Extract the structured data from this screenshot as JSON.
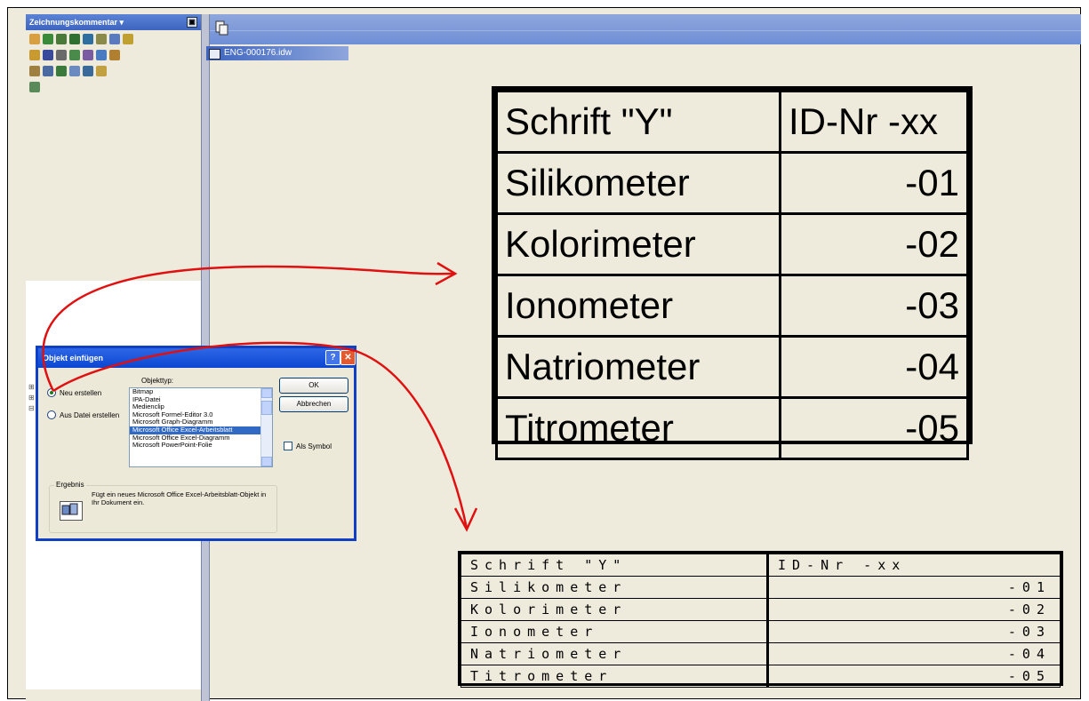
{
  "panel": {
    "title": "Zeichnungskommentar ▾"
  },
  "document": {
    "tab_title": "ENG-000176.idw"
  },
  "big_table": {
    "header": [
      "Schrift \"Y\"",
      "ID-Nr -xx"
    ],
    "rows": [
      [
        "Silikometer",
        "-01"
      ],
      [
        "Kolorimeter",
        "-02"
      ],
      [
        "Ionometer",
        "-03"
      ],
      [
        "Natriometer",
        "-04"
      ],
      [
        "Titrometer",
        "-05"
      ]
    ]
  },
  "small_table": {
    "header": [
      "Schrift \"Y\"",
      "ID-Nr -xx"
    ],
    "rows": [
      [
        "Silikometer",
        "-01"
      ],
      [
        "Kolorimeter",
        "-02"
      ],
      [
        "Ionometer",
        "-03"
      ],
      [
        "Natriometer",
        "-04"
      ],
      [
        "Titrometer",
        "-05"
      ]
    ]
  },
  "dialog": {
    "title": "Objekt einfügen",
    "help_label": "?",
    "close_label": "✕",
    "radio_new": "Neu erstellen",
    "radio_file": "Aus Datei erstellen",
    "type_label": "Objekttyp:",
    "list_items": [
      "Bitmap",
      "IPA-Datei",
      "Medienclip",
      "Microsoft Formel-Editor 3.0",
      "Microsoft Graph-Diagramm",
      "Microsoft Office Excel-Arbeitsblatt",
      "Microsoft Office Excel-Diagramm",
      "Microsoft PowerPoint-Folie"
    ],
    "selected_index": 5,
    "ok_label": "OK",
    "cancel_label": "Abbrechen",
    "symbol_label": "Als Symbol",
    "result_label": "Ergebnis",
    "result_text": "Fügt ein neues Microsoft Office Excel-Arbeitsblatt-Objekt in Ihr Dokument ein."
  },
  "colors": {
    "annotation": "#e01010",
    "background": "#eeebdc",
    "titlebar": "#0b46d2"
  }
}
